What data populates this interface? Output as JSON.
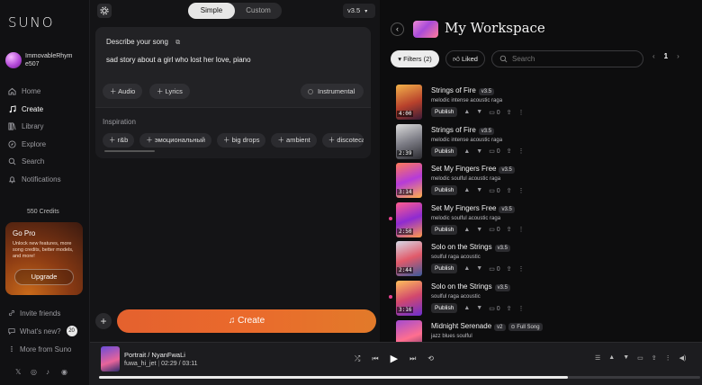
{
  "sidebar": {
    "logo": "SUNO",
    "username": "ImmovableRhym e507",
    "nav": [
      {
        "label": "Home",
        "icon": "home-icon"
      },
      {
        "label": "Create",
        "icon": "music-note-icon",
        "active": true
      },
      {
        "label": "Library",
        "icon": "library-icon"
      },
      {
        "label": "Explore",
        "icon": "compass-icon"
      },
      {
        "label": "Search",
        "icon": "search-icon"
      },
      {
        "label": "Notifications",
        "icon": "bell-icon"
      }
    ],
    "credits": "550 Credits",
    "gopro": {
      "title": "Go Pro",
      "text": "Unlock new features, more song credits, better models, and more!",
      "button": "Upgrade"
    },
    "bottom": {
      "invite": "Invite friends",
      "whats_new": "What's new?",
      "whats_new_count": "20",
      "more": "More from Suno"
    }
  },
  "create": {
    "mode_simple": "Simple",
    "mode_custom": "Custom",
    "version": "v3.5",
    "describe_label": "Describe your song",
    "describe_text": "sad story about a girl who lost her love, piano",
    "audio_label": "Audio",
    "lyrics_label": "Lyrics",
    "instrumental_label": "Instrumental",
    "inspiration_label": "Inspiration",
    "inspiration_chips": [
      "r&b",
      "эмоциональный",
      "big drops",
      "ambient",
      "discoteca"
    ],
    "create_label": "Create"
  },
  "workspace": {
    "title": "My Workspace",
    "filters_label": "Filters (2)",
    "liked_label": "Liked",
    "search_placeholder": "Search",
    "page": "1",
    "songs": [
      {
        "title": "Strings of Fire",
        "version": "v3.5",
        "genre": "melodic intense acoustic raga",
        "duration": "4:00",
        "likes": "0",
        "playing": false
      },
      {
        "title": "Strings of Fire",
        "version": "v3.5",
        "genre": "melodic intense acoustic raga",
        "duration": "2:39",
        "likes": "0",
        "playing": false
      },
      {
        "title": "Set My Fingers Free",
        "version": "v3.5",
        "genre": "melodic soulful acoustic raga",
        "duration": "3:14",
        "likes": "0",
        "playing": false
      },
      {
        "title": "Set My Fingers Free",
        "version": "v3.5",
        "genre": "melodic soulful acoustic raga",
        "duration": "2:50",
        "likes": "0",
        "playing": true
      },
      {
        "title": "Solo on the Strings",
        "version": "v3.5",
        "genre": "soulful raga acoustic",
        "duration": "2:44",
        "likes": "0",
        "playing": false
      },
      {
        "title": "Solo on the Strings",
        "version": "v3.5",
        "genre": "soulful raga acoustic",
        "duration": "3:16",
        "likes": "0",
        "playing": true
      },
      {
        "title": "Midnight Serenade",
        "version": "v2",
        "genre": "jazz blues soulful",
        "duration": "",
        "likes": "",
        "playing": false,
        "full_song": "Full Song"
      }
    ],
    "publish_label": "Publish"
  },
  "player": {
    "title": "Portrait / NyanFwaLi",
    "artist": "fuwa_hi_jet",
    "time": "02:29 / 03:11",
    "progress": 0.78
  },
  "colors": {
    "accent": "#e8642d",
    "playing_dot": "#e9418f"
  }
}
